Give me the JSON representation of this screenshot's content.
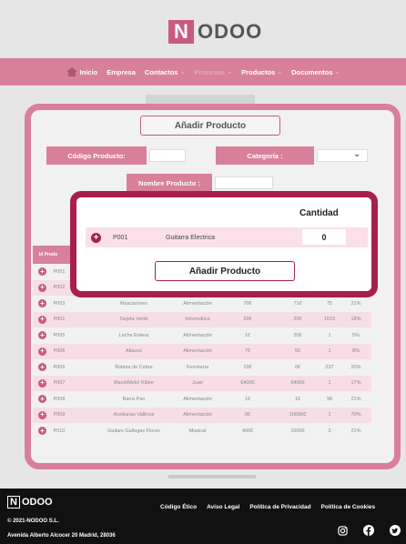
{
  "brand": {
    "logo_letter": "N",
    "logo_rest": "ODOO"
  },
  "nav": {
    "items": [
      {
        "label": "Inicio",
        "icon": "home-icon"
      },
      {
        "label": "Empresa"
      },
      {
        "label": "Contactos"
      },
      {
        "label": "Procesos"
      },
      {
        "label": "Productos"
      },
      {
        "label": "Documentos"
      }
    ]
  },
  "form": {
    "add_button": "Añadir Producto",
    "codigo_label": "Código Producto:",
    "categoria_label": "Categoría :",
    "nombre_label": "Nombre Producto :"
  },
  "table": {
    "header_first": "Id Produ",
    "rows": [
      {
        "id": "P001",
        "name": "",
        "cat": "",
        "p1": "",
        "p2": "",
        "q": "",
        "iva": ""
      },
      {
        "id": "P002",
        "name": "",
        "cat": "",
        "p1": "",
        "p2": "",
        "q": "",
        "iva": ""
      },
      {
        "id": "P003",
        "name": "Mascarones",
        "cat": "Alimentación",
        "p1": "70€",
        "p2": "71€",
        "q": "75",
        "iva": "21%"
      },
      {
        "id": "P001",
        "name": "Tarjeta Vertix",
        "cat": "Informática",
        "p1": "20€",
        "p2": "20€",
        "q": "1023",
        "iva": "18%"
      },
      {
        "id": "P005",
        "name": "Leche Entera",
        "cat": "Alimentación",
        "p1": "1€",
        "p2": "20€",
        "q": "1",
        "iva": "5%"
      },
      {
        "id": "P006",
        "name": "Altavoz",
        "cat": "Alimentación",
        "p1": "7€",
        "p2": "5€",
        "q": "1",
        "iva": "8%"
      },
      {
        "id": "P006",
        "name": "Bobina de Cobre",
        "cat": "Ferretería",
        "p1": "10€",
        "p2": "0€",
        "q": "237",
        "iva": "20%"
      },
      {
        "id": "P007",
        "name": "MarshMelo! Kibler",
        "cat": "Juan",
        "p1": "6400€",
        "p2": "6400€",
        "q": "1",
        "iva": "17%"
      },
      {
        "id": "P008",
        "name": "Barra Pan",
        "cat": "Alimentación",
        "p1": "1€",
        "p2": "1€",
        "q": "98",
        "iva": "21%"
      },
      {
        "id": "P009",
        "name": "Aceitunas Vallinos",
        "cat": "Alimentación",
        "p1": "0€",
        "p2": "10000€",
        "q": "1",
        "iva": "70%"
      },
      {
        "id": "P010",
        "name": "Guitars Gallegas Flores",
        "cat": "Musical",
        "p1": "400€",
        "p2": "1000€",
        "q": "2",
        "iva": "21%"
      }
    ]
  },
  "modal": {
    "cantidad_label": "Cantidad",
    "product_code": "P001",
    "product_name": "Guitarra Electrica",
    "quantity": "0",
    "submit_label": "Añadir Producto"
  },
  "footer": {
    "logo_letter": "N",
    "logo_rest": "ODOO",
    "copyright": "© 2021-NODOO S.L.",
    "address": "Avenida Alberto Alcocer 20 Madrid, 28036",
    "links": [
      "Código Ético",
      "Aviso Legal",
      "Política de Privacidad",
      "Política de Cookies"
    ],
    "social": [
      "instagram-icon",
      "facebook-icon",
      "twitter-icon"
    ]
  },
  "colors": {
    "accent": "#d8809b",
    "modal_border": "#a71f4f",
    "footer_bg": "#111111"
  }
}
